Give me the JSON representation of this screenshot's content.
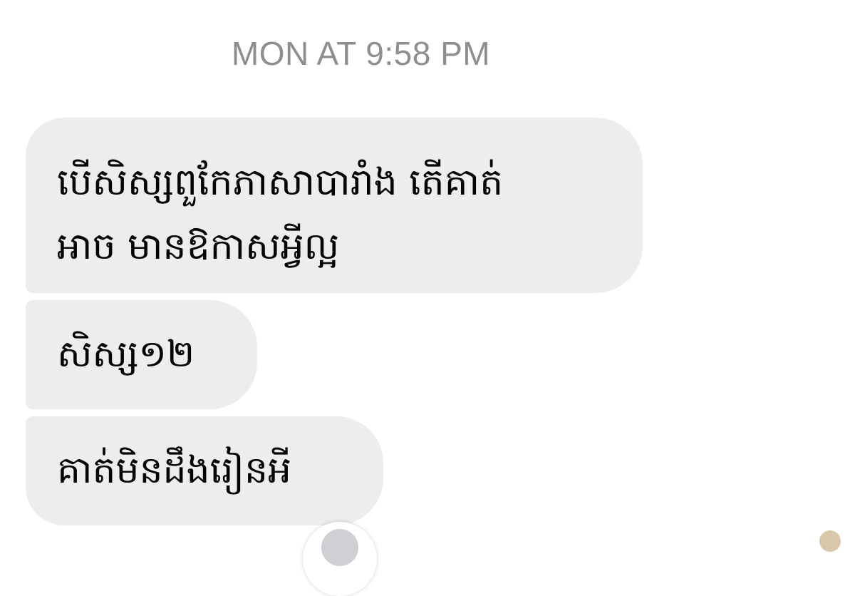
{
  "chat": {
    "timestamp": "MON AT 9:58 PM",
    "messages": [
      {
        "line1": "បើសិស្សពួកែភាសាបារាំង តើគាត់",
        "line2": "អាច មានឱកាសអ្វីល្អ"
      },
      {
        "text": "សិស្ស១២"
      },
      {
        "text": "គាត់មិនដឹងរៀនអី"
      }
    ]
  },
  "icons": {
    "reaction": "reaction-icon",
    "avatar": "avatar-icon"
  }
}
